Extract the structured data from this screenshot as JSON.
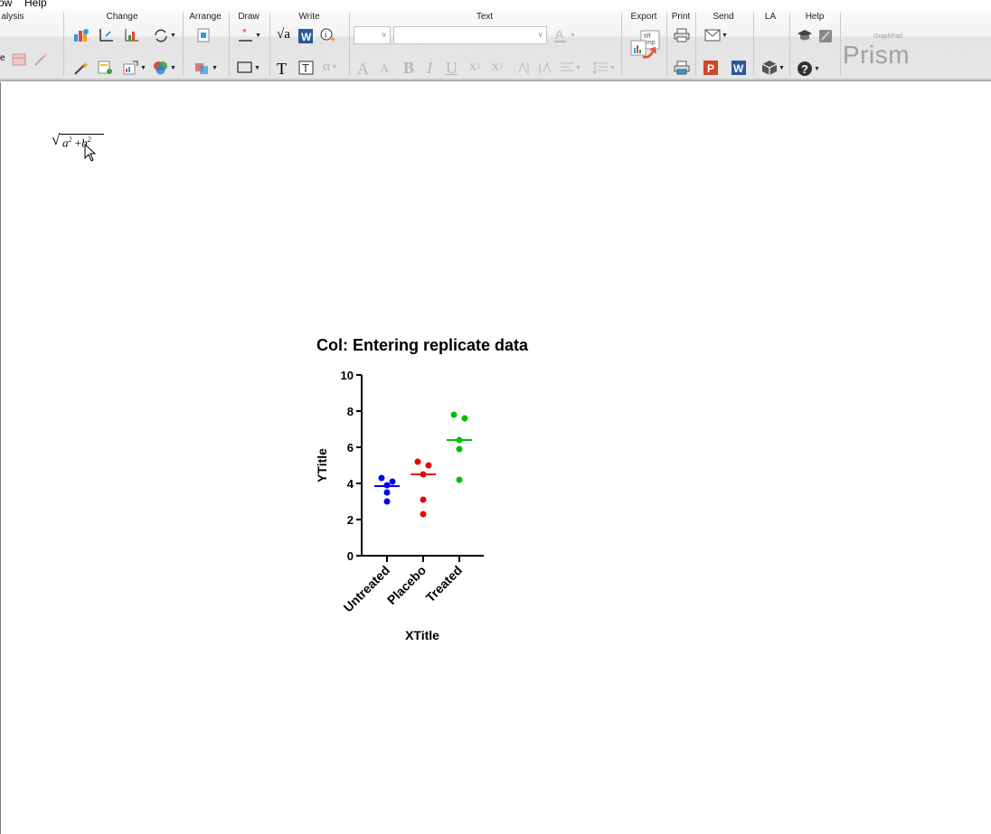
{
  "menu": {
    "items": [
      "ow",
      "Help"
    ]
  },
  "ribbon": {
    "groups": {
      "analysis": "alysis",
      "change": "Change",
      "arrange": "Arrange",
      "draw": "Draw",
      "write": "Write",
      "text": "Text",
      "export": "Export",
      "print": "Print",
      "send": "Send",
      "la": "LA",
      "help": "Help"
    },
    "partial_label": "e",
    "export_icon_text": "tiff bmp",
    "logo_small": "GraphPad",
    "logo": "Prism",
    "icons": [
      "chart-type-icon",
      "axes-icon",
      "swap-axes-icon",
      "cycle-icon",
      "magic-wand-icon",
      "insert-table-icon",
      "format-graph-icon",
      "colors-icon",
      "align-icon",
      "layers-icon",
      "draw-arrow-icon",
      "rectangle-icon",
      "sqrt-icon",
      "word-icon",
      "info-icon",
      "text-T-icon",
      "text-box-icon",
      "alpha-icon",
      "print-icon",
      "email-icon",
      "powerpoint-icon",
      "word-send-icon",
      "cube-icon",
      "help-icon"
    ]
  },
  "formula": {
    "label": "a² + b²",
    "a": "a",
    "plus": "+",
    "b": "b",
    "exp": "2"
  },
  "chart_data": {
    "type": "scatter",
    "title": "Col: Entering replicate data",
    "xlabel": "XTitle",
    "ylabel": "YTitle",
    "ylim": [
      0,
      10
    ],
    "yticks": [
      0,
      2,
      4,
      6,
      8,
      10
    ],
    "categories": [
      "Untreated",
      "Placebo",
      "Treated"
    ],
    "series": [
      {
        "name": "Untreated",
        "color": "#0000ee",
        "values": [
          4.3,
          4.1,
          3.9,
          3.5,
          3.0
        ],
        "mean": 3.85
      },
      {
        "name": "Placebo",
        "color": "#ee0000",
        "values": [
          5.2,
          5.0,
          4.5,
          3.1,
          2.3
        ],
        "mean": 4.5
      },
      {
        "name": "Treated",
        "color": "#00c000",
        "values": [
          7.8,
          7.6,
          6.4,
          5.9,
          4.2
        ],
        "mean": 6.4
      }
    ]
  }
}
